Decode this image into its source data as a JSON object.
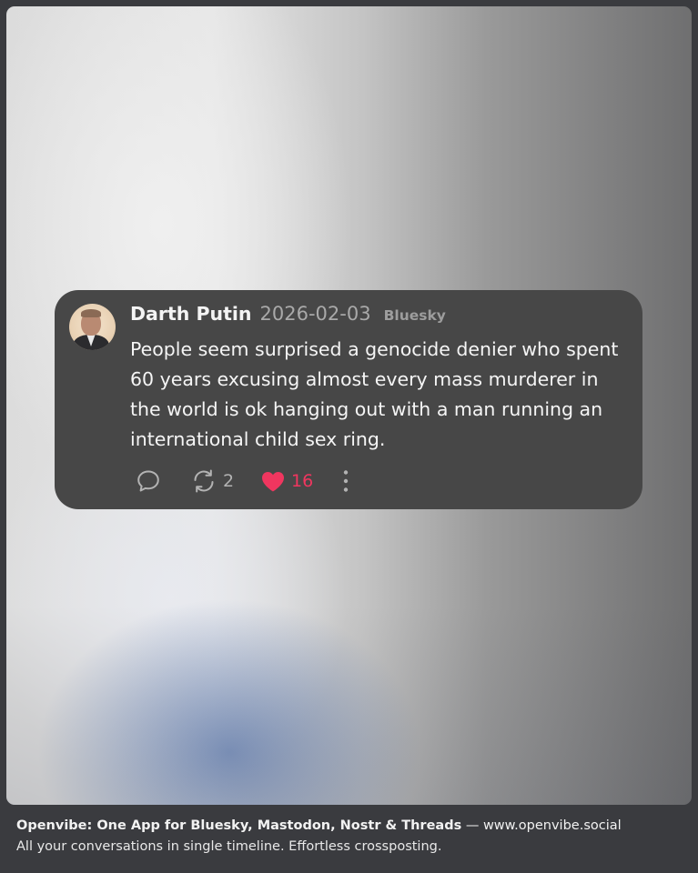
{
  "post": {
    "author": "Darth Putin",
    "date": "2026-02-03",
    "source": "Bluesky",
    "text": "People seem surprised a genocide denier who spent 60 years excusing almost every mass murderer in the world is ok hanging out with a man running an international child sex ring.",
    "reply_icon": "comment-bubble-icon",
    "repost_icon": "repost-arrows-icon",
    "repost_count": "2",
    "like_icon": "heart-icon",
    "like_count": "16",
    "more_icon": "more-vertical-icon",
    "liked_color": "#f0365f"
  },
  "footer": {
    "brand": "Openvibe: One App for Bluesky, Mastodon, Nostr & Threads",
    "separator": " — ",
    "url": "www.openvibe.social",
    "tagline": "All your conversations in single timeline. Effortless crossposting."
  }
}
